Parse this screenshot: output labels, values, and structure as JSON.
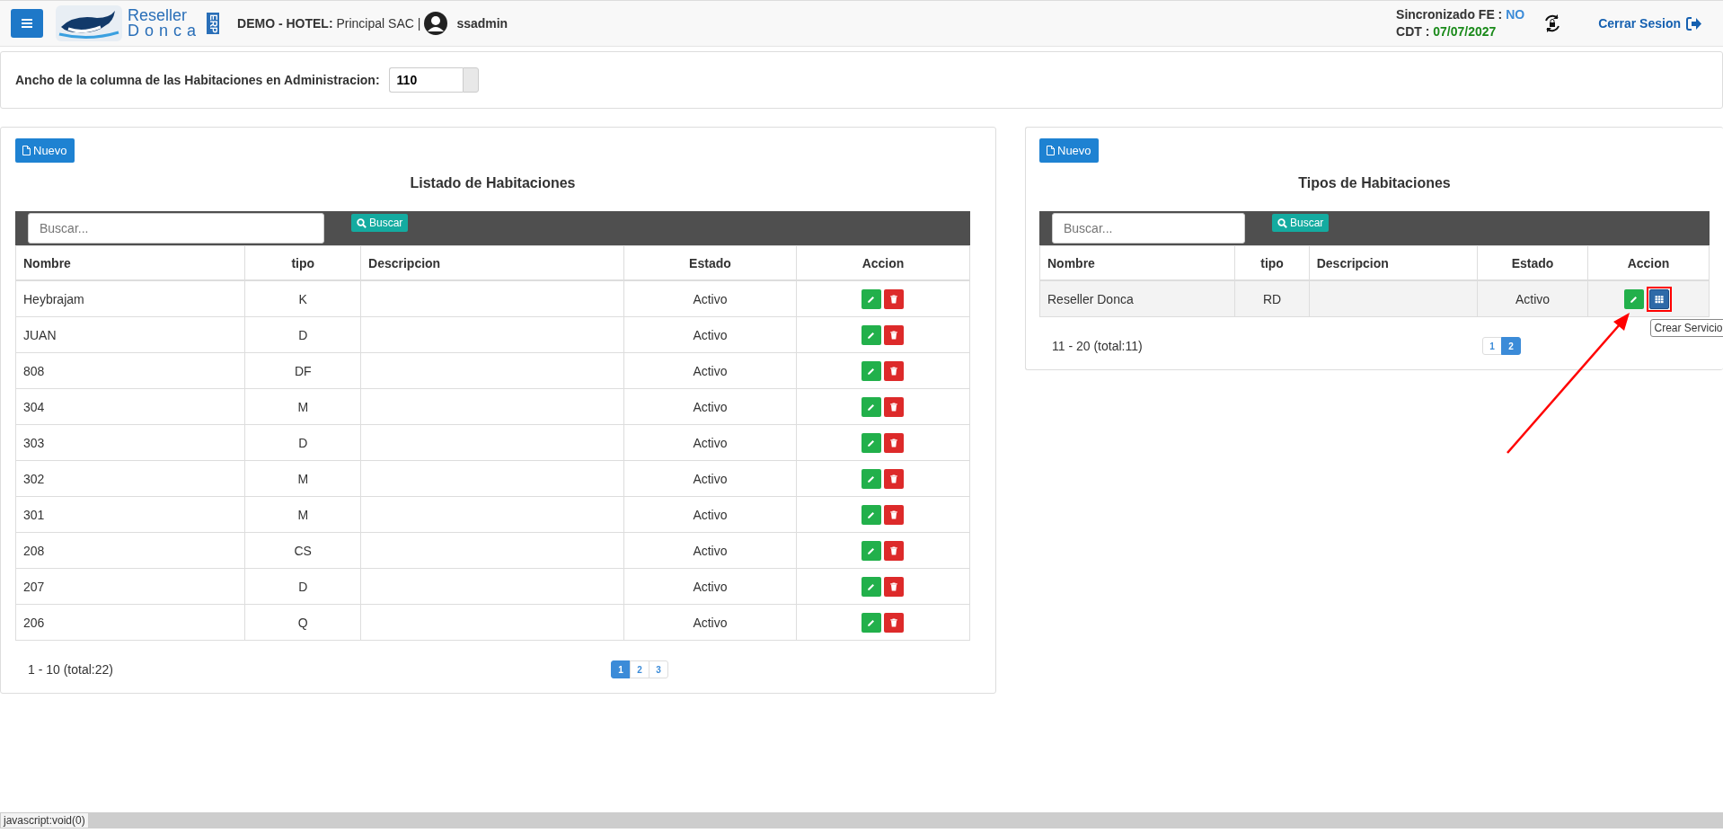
{
  "header": {
    "company_label": "DEMO - HOTEL:",
    "company_name": "Principal SAC |",
    "username": "ssadmin",
    "logo": {
      "line_1": "Reseller",
      "line_2": "Donca",
      "badge": "ERP"
    },
    "sync_label": "Sincronizado FE :",
    "sync_value": "NO",
    "cdt_label": "CDT :",
    "cdt_value": "07/07/2027",
    "logout": "Cerrar Sesion"
  },
  "settings": {
    "label": "Ancho de la columna de las Habitaciones en Administracion:",
    "value": "110"
  },
  "panels": [
    {
      "new_button": "Nuevo",
      "title": "Listado de Habitaciones",
      "search": {
        "placeholder": "Buscar...",
        "button": "Buscar"
      },
      "columns": [
        "Nombre",
        "tipo",
        "Descripcion",
        "Estado",
        "Accion"
      ],
      "rows": [
        {
          "nombre": "Heybrajam",
          "tipo": "K",
          "estado": "Activo",
          "hovered": false,
          "actions": [
            {
              "kind": "edit"
            },
            {
              "kind": "delete"
            }
          ]
        },
        {
          "nombre": "JUAN",
          "tipo": "D",
          "estado": "Activo",
          "hovered": false,
          "actions": [
            {
              "kind": "edit"
            },
            {
              "kind": "delete"
            }
          ]
        },
        {
          "nombre": "808",
          "tipo": "DF",
          "estado": "Activo",
          "hovered": false,
          "actions": [
            {
              "kind": "edit"
            },
            {
              "kind": "delete"
            }
          ]
        },
        {
          "nombre": "304",
          "tipo": "M",
          "estado": "Activo",
          "hovered": false,
          "actions": [
            {
              "kind": "edit"
            },
            {
              "kind": "delete"
            }
          ]
        },
        {
          "nombre": "303",
          "tipo": "D",
          "estado": "Activo",
          "hovered": false,
          "actions": [
            {
              "kind": "edit"
            },
            {
              "kind": "delete"
            }
          ]
        },
        {
          "nombre": "302",
          "tipo": "M",
          "estado": "Activo",
          "hovered": false,
          "actions": [
            {
              "kind": "edit"
            },
            {
              "kind": "delete"
            }
          ]
        },
        {
          "nombre": "301",
          "tipo": "M",
          "estado": "Activo",
          "hovered": false,
          "actions": [
            {
              "kind": "edit"
            },
            {
              "kind": "delete"
            }
          ]
        },
        {
          "nombre": "208",
          "tipo": "CS",
          "estado": "Activo",
          "hovered": false,
          "actions": [
            {
              "kind": "edit"
            },
            {
              "kind": "delete"
            }
          ]
        },
        {
          "nombre": "207",
          "tipo": "D",
          "estado": "Activo",
          "hovered": false,
          "actions": [
            {
              "kind": "edit"
            },
            {
              "kind": "delete"
            }
          ]
        },
        {
          "nombre": "206",
          "tipo": "Q",
          "estado": "Activo",
          "hovered": false,
          "actions": [
            {
              "kind": "edit"
            },
            {
              "kind": "delete"
            }
          ]
        }
      ],
      "range": "1 - 10 (total:22)",
      "pages": [
        {
          "label": "1",
          "selected": true
        },
        {
          "label": "2",
          "selected": false
        },
        {
          "label": "3",
          "selected": false
        }
      ]
    },
    {
      "new_button": "Nuevo",
      "title": "Tipos de Habitaciones",
      "search": {
        "placeholder": "Buscar...",
        "button": "Buscar"
      },
      "columns": [
        "Nombre",
        "tipo",
        "Descripcion",
        "Estado",
        "Accion"
      ],
      "rows": [
        {
          "nombre": "Reseller Donca",
          "tipo": "RD",
          "estado": "Activo",
          "hovered": true,
          "actions": [
            {
              "kind": "edit"
            },
            {
              "kind": "services",
              "highlighted": true,
              "tooltip": "Crear Servicio"
            }
          ]
        }
      ],
      "range": "11 - 20 (total:11)",
      "pages": [
        {
          "label": "1",
          "selected": false
        },
        {
          "label": "2",
          "selected": true
        }
      ]
    }
  ],
  "status_bar": {
    "text": "javascript:void(0)"
  }
}
